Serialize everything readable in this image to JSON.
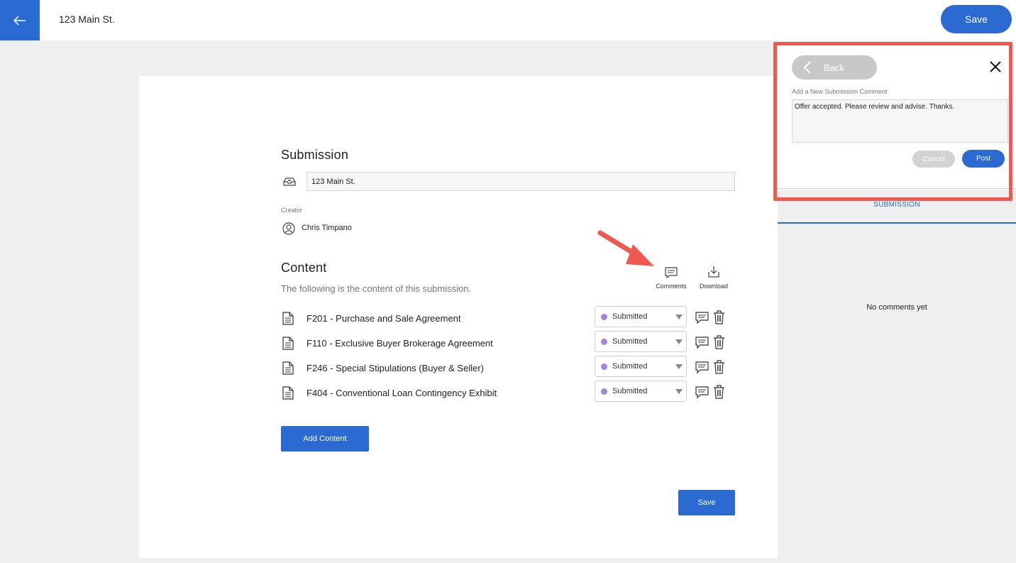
{
  "header": {
    "title": "123 Main St.",
    "save_label": "Save"
  },
  "submission": {
    "title": "Submission",
    "name_value": "123 Main St.",
    "creator_label": "Creator",
    "creator_name": "Chris Timpano"
  },
  "content": {
    "title": "Content",
    "subtitle": "The following is the content of this submission.",
    "tools": {
      "comments_label": "Comments",
      "download_label": "Download"
    },
    "items": [
      {
        "label": "F201 - Purchase and Sale Agreement",
        "status": "Submitted"
      },
      {
        "label": "F110 - Exclusive Buyer Brokerage Agreement",
        "status": "Submitted"
      },
      {
        "label": "F246 - Special Stipulations (Buyer & Seller)",
        "status": "Submitted"
      },
      {
        "label": "F404 - Conventional Loan Contingency Exhibit",
        "status": "Submitted"
      }
    ],
    "add_label": "Add Content",
    "save_label": "Save"
  },
  "panel": {
    "back_label": "Back",
    "comment_field_label": "Add a New Submission Comment",
    "comment_value": "Offer accepted. Please review and advise. Thanks.",
    "cancel_label": "Cancel",
    "post_label": "Post",
    "tab_label": "SUBMISSION",
    "empty_text": "No comments yet"
  },
  "colors": {
    "accent": "#2a6ad1",
    "status_dot": "#a683d8",
    "highlight": "#ee5a4f"
  }
}
